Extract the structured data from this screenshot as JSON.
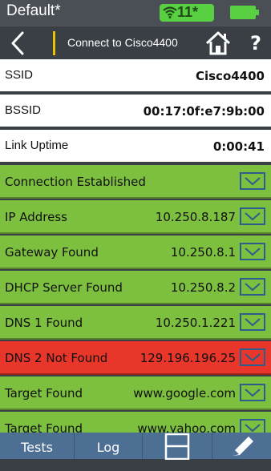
{
  "status": {
    "profile": "Default*",
    "wifi_count": "11*",
    "wifi_icon": "wifi-icon",
    "battery_icon": "battery-icon"
  },
  "nav": {
    "title": "Connect to Cisco4400",
    "help": "?",
    "back_icon": "chevron-left-icon",
    "home_icon": "home-icon"
  },
  "info": [
    {
      "label": "SSID",
      "value": "Cisco4400"
    },
    {
      "label": "BSSID",
      "value": "00:17:0f:e7:9b:00"
    },
    {
      "label": "Link Uptime",
      "value": "0:00:41"
    }
  ],
  "results": [
    {
      "label": "Connection Established",
      "value": "",
      "status": "pass"
    },
    {
      "label": "IP Address",
      "value": "10.250.8.187",
      "status": "pass"
    },
    {
      "label": "Gateway Found",
      "value": "10.250.8.1",
      "status": "pass"
    },
    {
      "label": "DHCP Server Found",
      "value": "10.250.8.2",
      "status": "pass"
    },
    {
      "label": "DNS 1 Found",
      "value": "10.250.1.221",
      "status": "pass"
    },
    {
      "label": "DNS 2 Not Found",
      "value": "129.196.196.25",
      "status": "fail"
    },
    {
      "label": "Target Found",
      "value": "www.google.com",
      "status": "pass"
    },
    {
      "label": "Target Found",
      "value": "www.yahoo.com",
      "status": "pass"
    }
  ],
  "colors": {
    "pass": "#7dbf3f",
    "fail": "#e8362a",
    "bar": "#4e6f94"
  },
  "tabs": {
    "tests": "Tests",
    "log": "Log",
    "save_icon": "save-icon",
    "edit_icon": "pencil-icon"
  }
}
